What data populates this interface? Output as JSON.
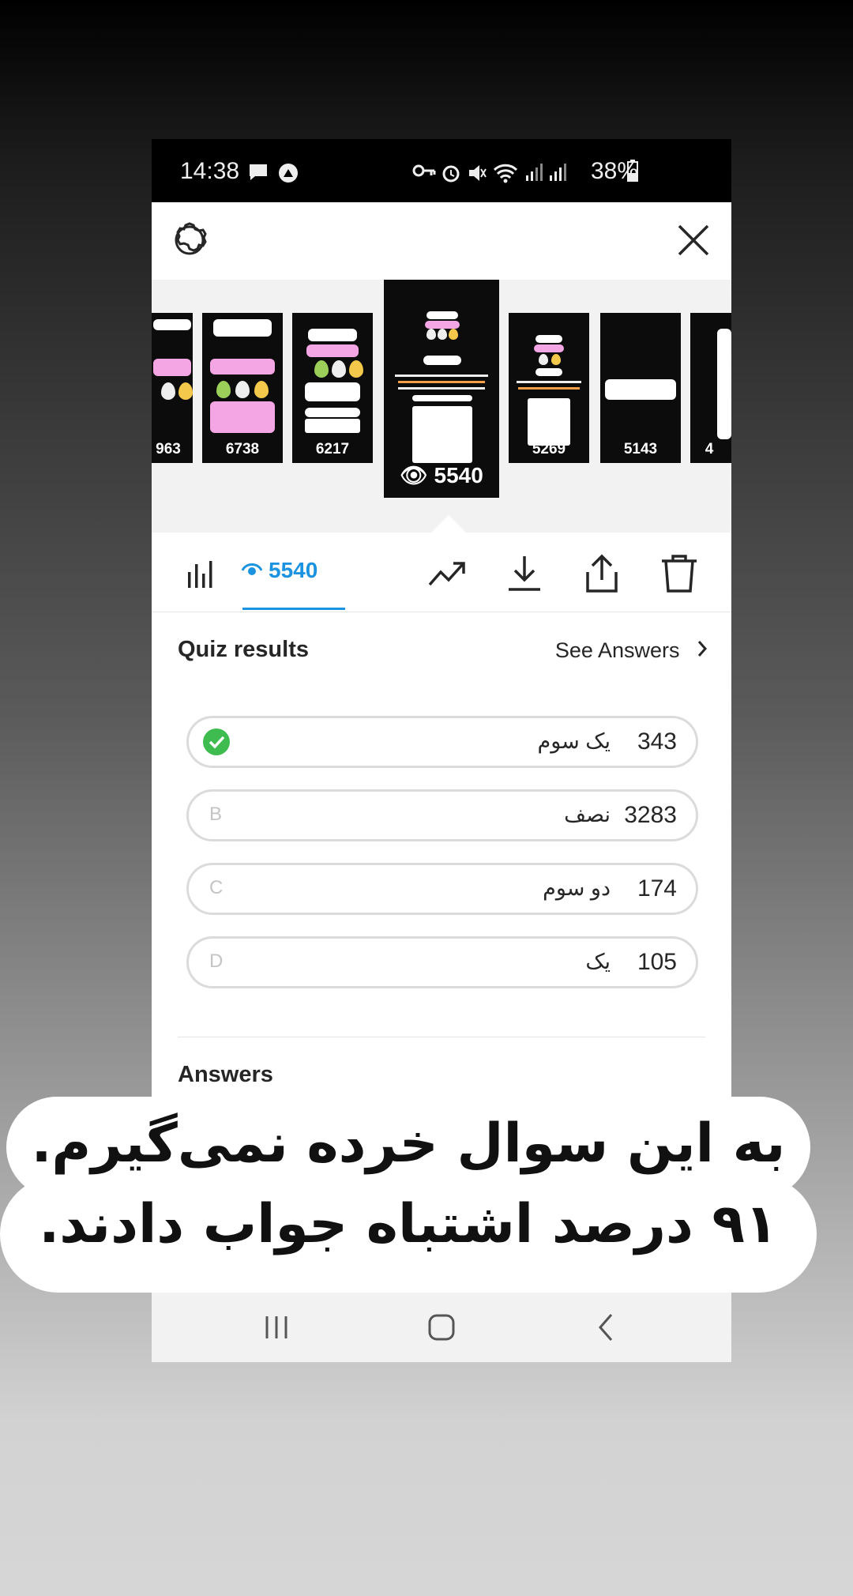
{
  "status_bar": {
    "time": "14:38",
    "battery": "38%",
    "icons": [
      "message-icon",
      "app-notification-icon",
      "key-icon",
      "alarm-icon",
      "mute-icon",
      "wifi-icon",
      "signal-icon",
      "signal-icon",
      "battery-icon"
    ]
  },
  "top_bar": {
    "icons": [
      "settings-gear-icon",
      "close-icon"
    ]
  },
  "story_thumbnails": [
    {
      "views": "963"
    },
    {
      "views": "6738"
    },
    {
      "views": "6217"
    },
    {
      "views": "5540",
      "selected": true
    },
    {
      "views": "5269"
    },
    {
      "views": "5143"
    },
    {
      "views": "4"
    }
  ],
  "action_bar": {
    "viewers_count": "5540",
    "accent_color": "#1b93e0",
    "icons": [
      "insights-bars-icon",
      "eye-icon",
      "trend-icon",
      "download-icon",
      "share-icon",
      "delete-icon"
    ]
  },
  "quiz": {
    "title": "Quiz results",
    "see_answers": "See Answers",
    "options": [
      {
        "letter": "",
        "correct": true,
        "label": "یک سوم",
        "count": "343"
      },
      {
        "letter": "B",
        "correct": false,
        "label": "نصف",
        "count": "3283"
      },
      {
        "letter": "C",
        "correct": false,
        "label": "دو سوم",
        "count": "174"
      },
      {
        "letter": "D",
        "correct": false,
        "label": "یک",
        "count": "105"
      }
    ],
    "answers_title": "Answers"
  },
  "caption": {
    "line1": "به این سوال خرده نمی‌گیرم.",
    "line2": "۹۱ درصد اشتباه جواب دادند."
  },
  "nav_bar": {
    "icons": [
      "recents-icon",
      "home-icon",
      "back-icon"
    ]
  }
}
